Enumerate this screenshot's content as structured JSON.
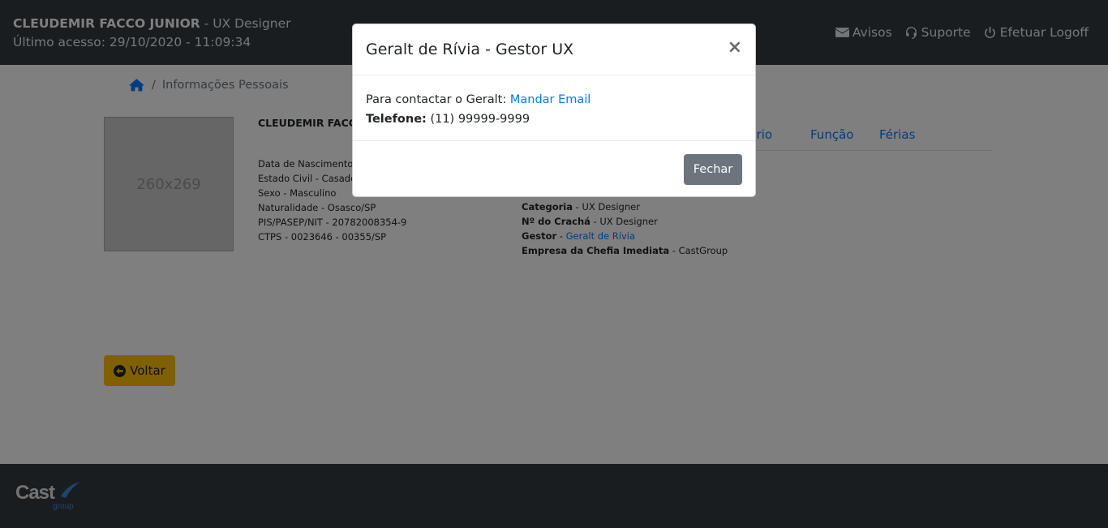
{
  "header": {
    "user_name": "CLEUDEMIR FACCO JUNIOR",
    "user_role": " - UX Designer",
    "last_access": "Último acesso: 29/10/2020 - 11:09:34",
    "links": {
      "notices": "Avisos",
      "support": "Suporte",
      "logoff": "Efetuar Logoff"
    }
  },
  "breadcrumb": {
    "separator": "/",
    "current": "Informações Pessoais"
  },
  "profile": {
    "photo_placeholder": "260x269",
    "name": "CLEUDEMIR FACCO",
    "lines": [
      "Data de Nascimento -",
      "Estado Civil - Casado",
      "Sexo - Masculino",
      "Naturalidade - Osasco/SP",
      "PIS/PASEP/NIT - 20782008354-9",
      "CTPS - 0023646 - 00355/SP"
    ]
  },
  "tabs": {
    "salary": "alário",
    "function": "Função",
    "vacation": "Férias"
  },
  "work": {
    "category_label": "Categoria",
    "category_value": " - UX Designer",
    "badge_label": "Nº do Crachá",
    "badge_value": " - UX Designer",
    "manager_label": "Gestor",
    "manager_sep": " - ",
    "manager_value": "Geralt de Rívia",
    "company_label": "Empresa da Chefia Imediata",
    "company_value": " - CastGroup"
  },
  "back_button": "Voltar",
  "footer": {
    "logo_text": "Cast",
    "logo_sub": "group"
  },
  "modal": {
    "title": "Geralt de Rívia - Gestor UX",
    "close_symbol": "×",
    "contact_text": "Para contactar o Geralt: ",
    "email_link": "Mandar Email",
    "phone_label": "Telefone:",
    "phone_value": " (11) 99999-9999",
    "close_button": "Fechar"
  },
  "colors": {
    "header_bg": "#343a40",
    "link": "#007bff",
    "warning": "#ffc107",
    "secondary": "#6c757d"
  }
}
